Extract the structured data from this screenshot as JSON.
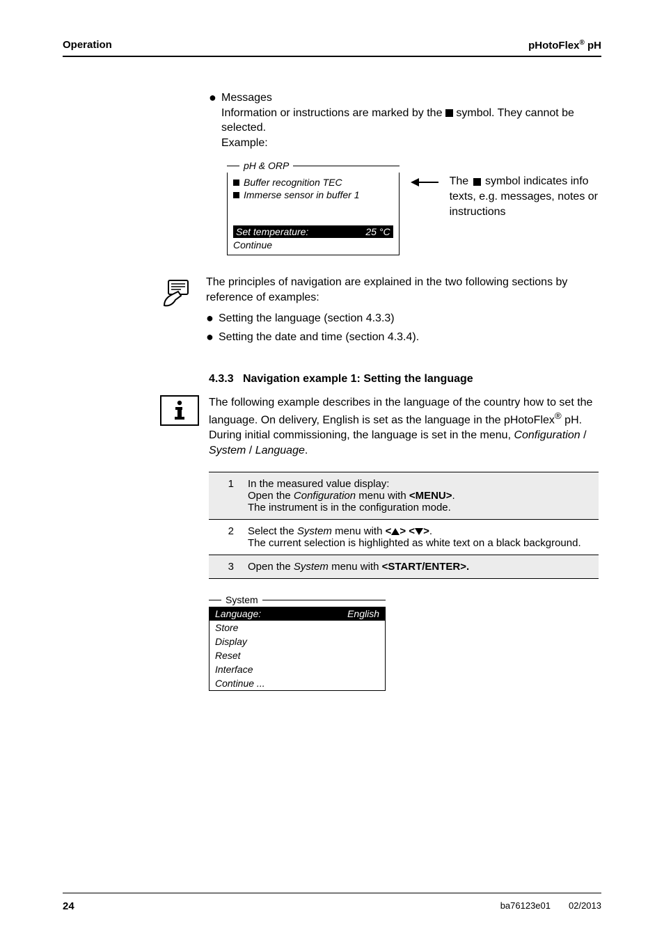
{
  "header": {
    "left": "Operation",
    "right_prefix": "pHotoFlex",
    "right_sup": "®",
    "right_suffix": " pH"
  },
  "messages": {
    "title": "Messages",
    "body_a": "Information or instructions are marked by the ",
    "body_b": " symbol. They cannot be selected.",
    "example_label": "Example:"
  },
  "ph_orp_box": {
    "title": "pH & ORP",
    "line1": "Buffer recognition TEC",
    "line2": "Immerse sensor in buffer 1",
    "set_temp_label": "Set temperature",
    "set_temp_value": "25 °C",
    "continue": "Continue"
  },
  "annotation": {
    "a": "The ",
    "b": " symbol indicates info texts, e.g. messages, notes or instructions"
  },
  "nav_note": {
    "intro": "The principles of navigation are explained in the two following sections by reference of examples:",
    "b1": "Setting the language (section 4.3.3)",
    "b2": "Setting the date and time (section 4.3.4)."
  },
  "section": {
    "number": "4.3.3",
    "title": "Navigation example 1: Setting the language"
  },
  "info": {
    "text_a": "The following example describes in the language of the country how to set the language. On delivery, English is set as the language in the pHotoFlex",
    "sup": "®",
    "text_b": " pH. During initial commissioning, the language is set in the menu, ",
    "path_config": "Configuration",
    "sep": " / ",
    "path_system": "System",
    "path_language": "Language",
    "dot": "."
  },
  "steps": [
    {
      "n": "1",
      "l1": "In the measured value display:",
      "l2a": "Open the ",
      "l2_conf": "Configuration",
      "l2b": " menu with ",
      "l2_menu": "<MENU>",
      "l2c": ".",
      "l3": "The instrument is in the configuration mode."
    },
    {
      "n": "2",
      "l1a": "Select the ",
      "l1_sys": "System",
      "l1b": " menu with ",
      "l2": "The current selection is highlighted as white text on a black background."
    },
    {
      "n": "3",
      "l1a": "Open the ",
      "l1_sys": "System",
      "l1b": " menu with ",
      "l1_se": "<START/ENTER>."
    }
  ],
  "system_box": {
    "title": "System",
    "language_label": "Language",
    "language_value": "English",
    "store": "Store",
    "display": "Display",
    "reset": "Reset",
    "interface": "Interface",
    "continue": "Continue ..."
  },
  "footer": {
    "page": "24",
    "doc": "ba76123e01",
    "date": "02/2013"
  }
}
